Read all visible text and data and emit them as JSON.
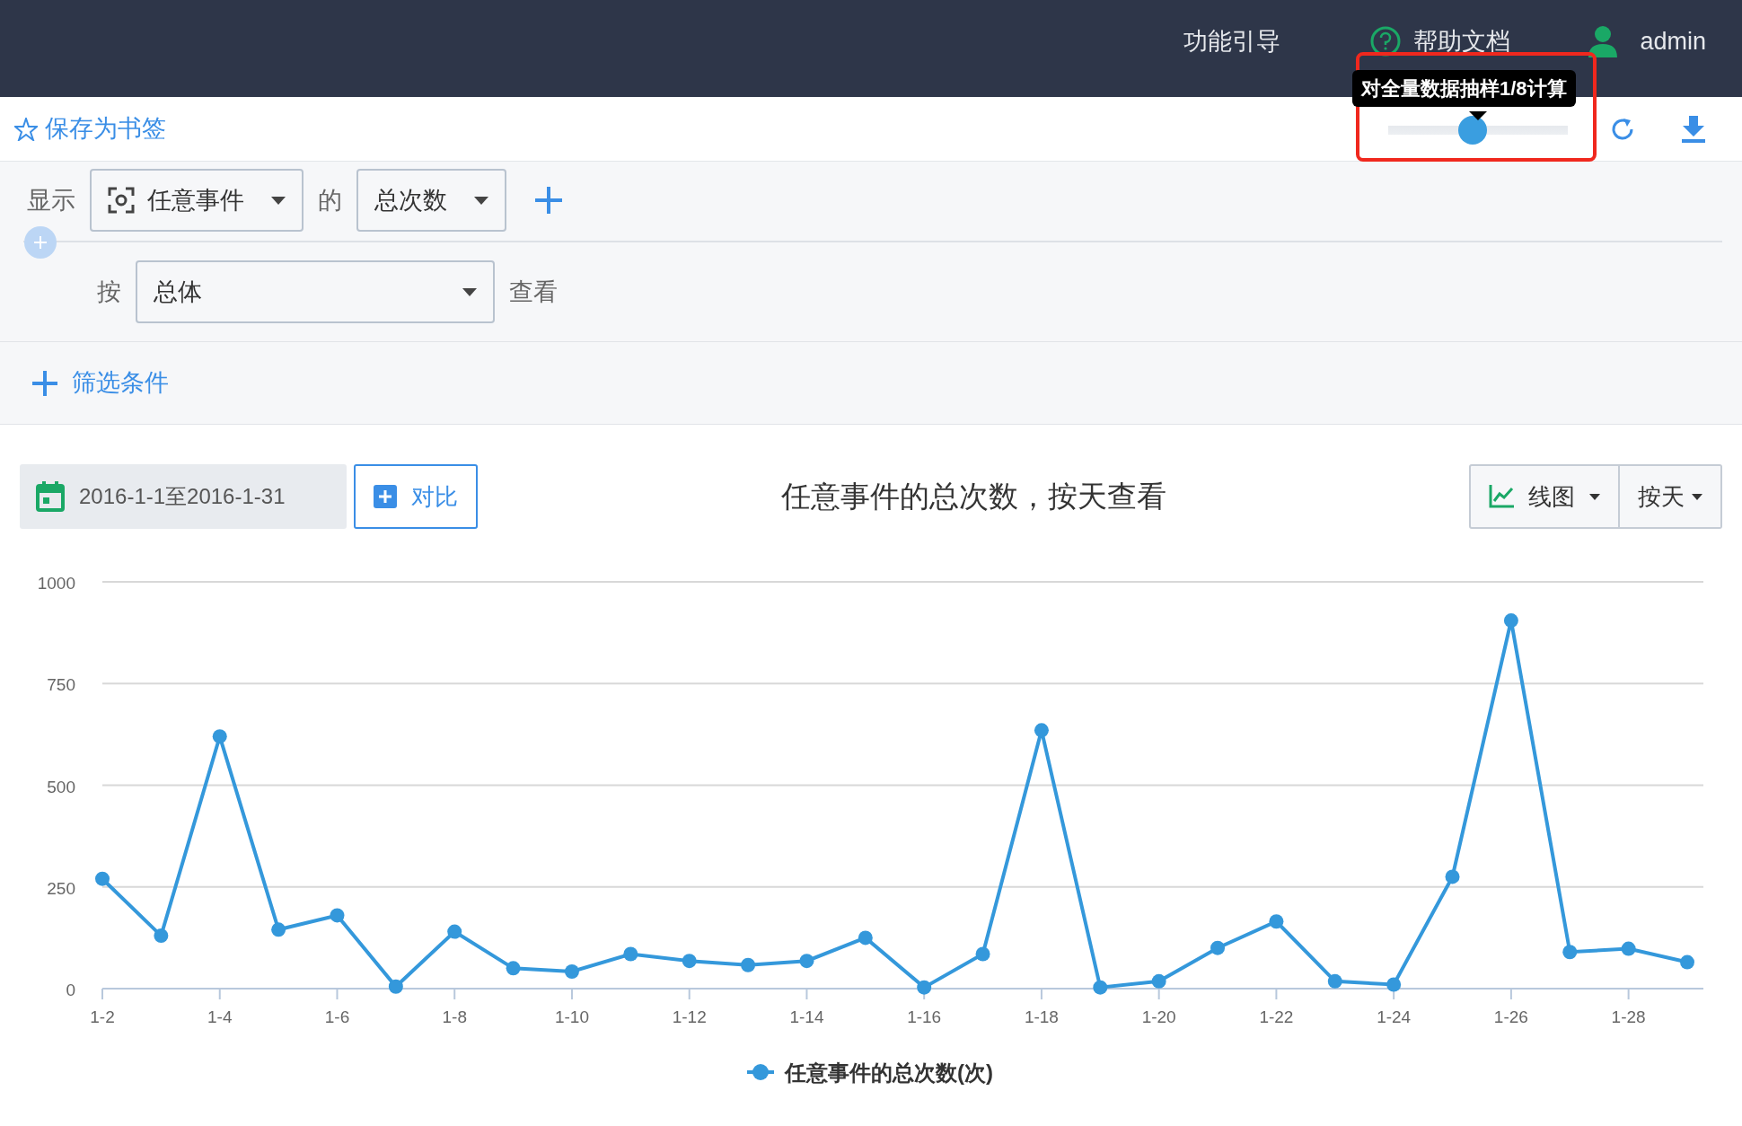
{
  "header": {
    "nav_links": [
      "功能引导",
      "帮助文档"
    ],
    "user": "admin"
  },
  "toolbar": {
    "bookmark": "保存为书签",
    "sampling_slider": {
      "level": 0.47,
      "tooltip": "对全量数据抽样1/8计算",
      "highlighted": true
    }
  },
  "query": {
    "show_label": "显示",
    "event_select": "任意事件",
    "of_label": "的",
    "metric_select": "总次数",
    "by_label": "按",
    "group_select": "总体",
    "view_label": "查看",
    "filter_link": "筛选条件"
  },
  "chart_header": {
    "date_range": "2016-1-1至2016-1-31",
    "compare_button": "对比",
    "title": "任意事件的总次数，按天查看",
    "chart_type": "线图",
    "granularity": "按天"
  },
  "chart_data": {
    "type": "line",
    "grid": true,
    "categories": [
      "1-2",
      null,
      "1-4",
      null,
      "1-6",
      null,
      "1-8",
      null,
      "1-10",
      null,
      "1-12",
      null,
      "1-14",
      null,
      "1-16",
      null,
      "1-18",
      null,
      "1-20",
      null,
      "1-22",
      null,
      "1-24",
      null,
      "1-26",
      null,
      "1-28",
      null
    ],
    "series": [
      {
        "name": "任意事件的总次数(次)",
        "color": "#3498db",
        "marker": "circle",
        "values": [
          270,
          130,
          620,
          145,
          180,
          5,
          140,
          50,
          42,
          85,
          68,
          58,
          68,
          125,
          3,
          85,
          635,
          3,
          18,
          100,
          165,
          18,
          10,
          275,
          905,
          90,
          98,
          65
        ]
      }
    ],
    "ylim": [
      0,
      1000
    ],
    "yticks": [
      0,
      250,
      500,
      750,
      1000
    ]
  }
}
